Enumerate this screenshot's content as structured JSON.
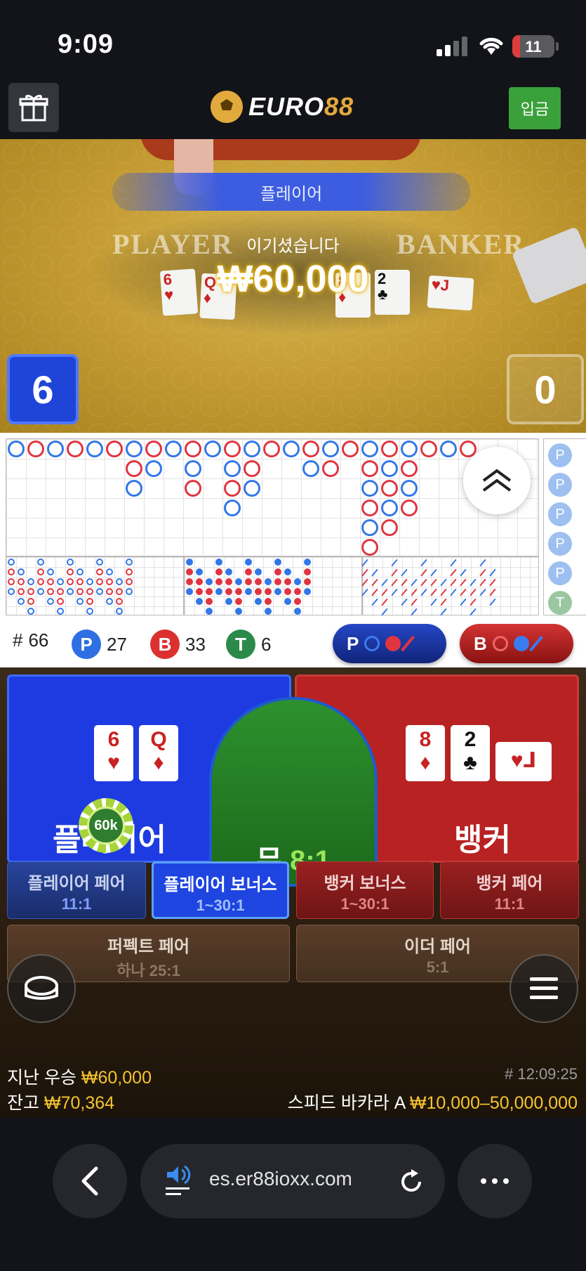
{
  "status_bar": {
    "time": "9:09",
    "battery": "11"
  },
  "header": {
    "logo_prefix": "EURO",
    "logo_suffix": "88",
    "deposit_label": "입금"
  },
  "video": {
    "winner_banner": "플레이어",
    "player_text": "PLAYER",
    "banker_text": "BANKER",
    "win_label": "이기셨습니다",
    "win_amount": "₩60,000",
    "player_score": "6",
    "banker_score": "0"
  },
  "stats": {
    "round_prefix": "#",
    "round_number": "66",
    "player_letter": "P",
    "player_count": "27",
    "banker_letter": "B",
    "banker_count": "33",
    "tie_letter": "T",
    "tie_count": "6",
    "ask_player": "P",
    "ask_banker": "B"
  },
  "bet": {
    "player_label": "플레이어",
    "banker_label": "뱅커",
    "tie_label": "무",
    "tie_odds": "8:1",
    "chip_value": "60k",
    "player_cards": [
      {
        "rank": "6",
        "suit": "♥"
      },
      {
        "rank": "Q",
        "suit": "♦"
      }
    ],
    "banker_cards": [
      {
        "rank": "8",
        "suit": "♦"
      },
      {
        "rank": "2",
        "suit": "♣"
      }
    ],
    "side_bets": [
      {
        "title": "플레이어 페어",
        "odds": "11:1"
      },
      {
        "title": "플레이어 보너스",
        "odds": "1~30:1"
      },
      {
        "title": "뱅커 보너스",
        "odds": "1~30:1"
      },
      {
        "title": "뱅커 페어",
        "odds": "11:1"
      },
      {
        "title": "퍼펙트 페어",
        "odds": "하나 25:1"
      },
      {
        "title": "이더 페어",
        "odds": "5:1"
      }
    ]
  },
  "info": {
    "last_win_label": "지난 우승",
    "last_win_value": "₩60,000",
    "balance_label": "잔고",
    "balance_value": "₩70,364",
    "timestamp": "# 12:09:25",
    "table_name": "스피드 바카라 A",
    "limits": "₩10,000–50,000,000"
  },
  "browser": {
    "url": "es.er88ioxx.com"
  },
  "colors": {
    "player": "#1d3be0",
    "banker": "#b82222",
    "tie": "#2a8a2a",
    "gold": "#f7c430"
  },
  "icons": [
    "gift-icon",
    "chevron-up-double-icon",
    "chat-bubble-icon",
    "menu-icon",
    "back-icon",
    "speaker-icon",
    "reload-icon",
    "more-icon"
  ]
}
